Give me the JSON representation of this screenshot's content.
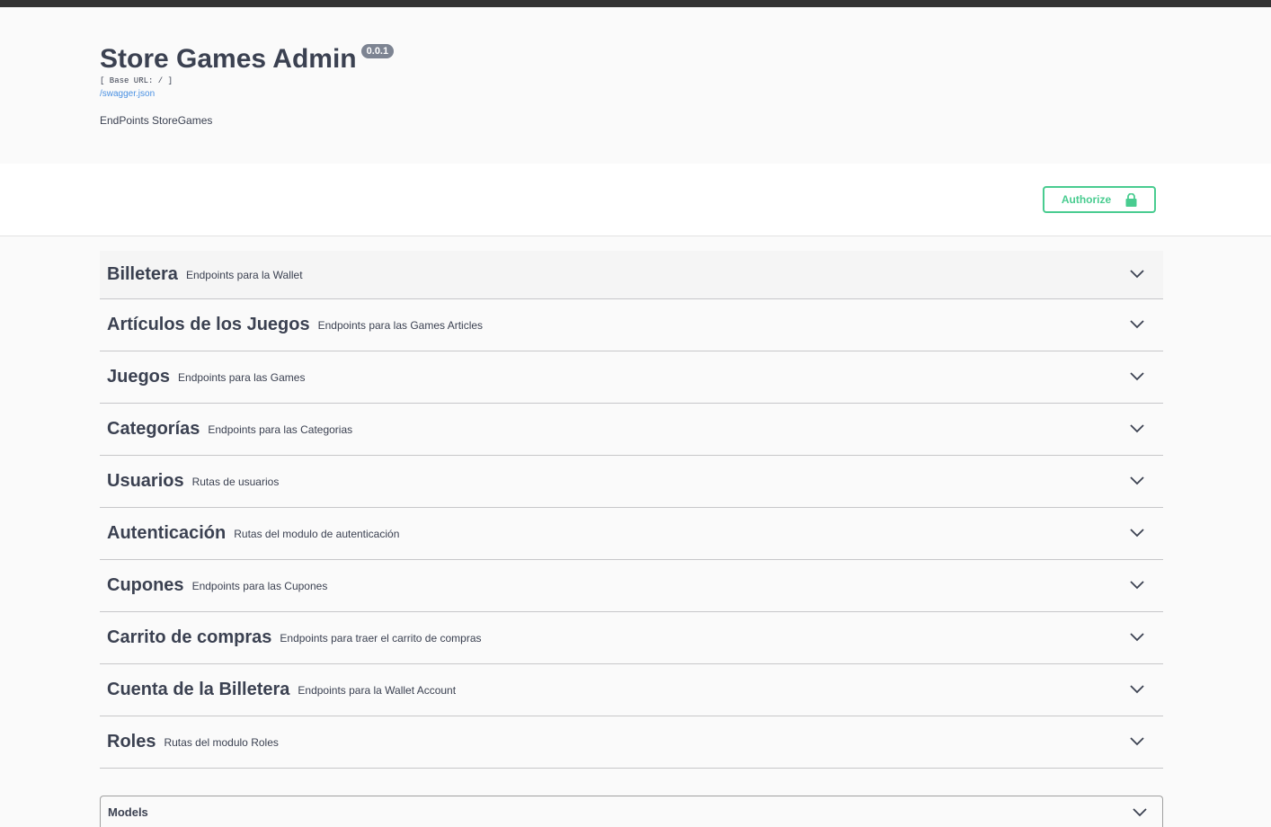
{
  "info": {
    "title": "Store Games Admin",
    "version": "0.0.1",
    "base_url": "[ Base URL: / ]",
    "spec_link": "/swagger.json",
    "description": "EndPoints StoreGames"
  },
  "auth": {
    "authorize_label": "Authorize"
  },
  "tags": [
    {
      "name": "Billetera",
      "description": "Endpoints para la Wallet"
    },
    {
      "name": "Artículos de los Juegos",
      "description": "Endpoints para las Games Articles"
    },
    {
      "name": "Juegos",
      "description": "Endpoints para las Games"
    },
    {
      "name": "Categorías",
      "description": "Endpoints para las Categorias"
    },
    {
      "name": "Usuarios",
      "description": "Rutas de usuarios"
    },
    {
      "name": "Autenticación",
      "description": "Rutas del modulo de autenticación"
    },
    {
      "name": "Cupones",
      "description": "Endpoints para las Cupones"
    },
    {
      "name": "Carrito de compras",
      "description": "Endpoints para traer el carrito de compras"
    },
    {
      "name": "Cuenta de la Billetera",
      "description": "Endpoints para la Wallet Account"
    },
    {
      "name": "Roles",
      "description": "Rutas del modulo Roles"
    }
  ],
  "models": {
    "title": "Models"
  },
  "colors": {
    "accent_green": "#49cc90",
    "text": "#3b4151",
    "link": "#4990e2",
    "version_badge": "#7d8492"
  },
  "icons": {
    "authorize": "lock-icon",
    "expand": "chevron-down-icon"
  }
}
